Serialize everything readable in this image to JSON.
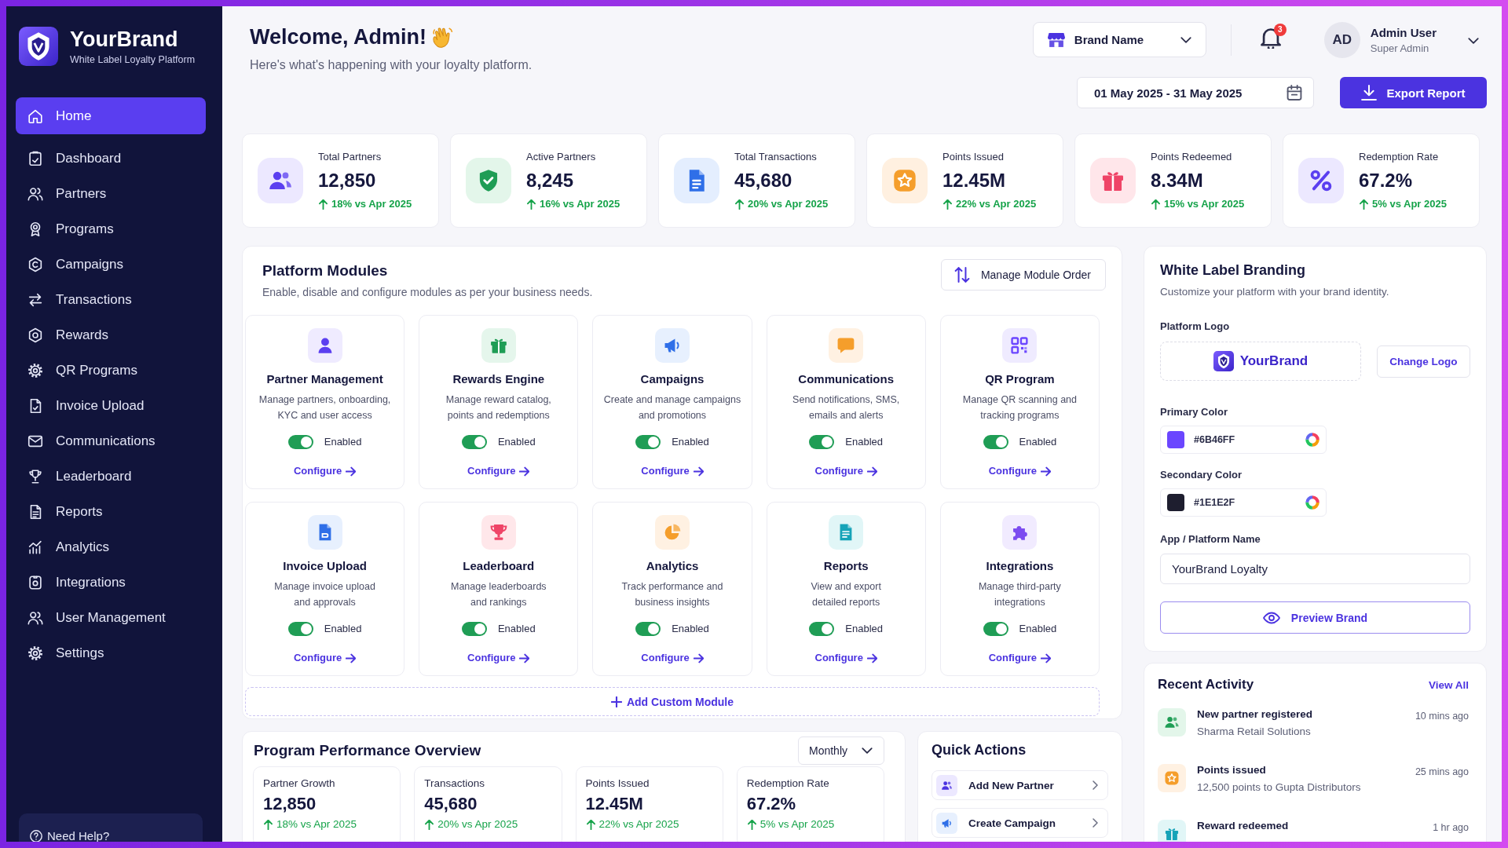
{
  "sidebar": {
    "brand": {
      "name": "YourBrand",
      "tagline": "White Label Loyalty Platform"
    },
    "items": [
      {
        "label": "Home",
        "selected": true
      },
      {
        "label": "Dashboard",
        "selected": false
      },
      {
        "label": "Partners",
        "selected": false
      },
      {
        "label": "Programs",
        "selected": false
      },
      {
        "label": "Campaigns",
        "selected": false
      },
      {
        "label": "Transactions",
        "selected": false
      },
      {
        "label": "Rewards",
        "selected": false
      },
      {
        "label": "QR Programs",
        "selected": false
      },
      {
        "label": "Invoice Upload",
        "selected": false
      },
      {
        "label": "Communications",
        "selected": false
      },
      {
        "label": "Leaderboard",
        "selected": false
      },
      {
        "label": "Reports",
        "selected": false
      },
      {
        "label": "Analytics",
        "selected": false
      },
      {
        "label": "Integrations",
        "selected": false
      },
      {
        "label": "User Management",
        "selected": false
      },
      {
        "label": "Settings",
        "selected": false
      }
    ],
    "help": {
      "label": "Need Help?"
    }
  },
  "header": {
    "title": "Welcome, Admin!",
    "subtitle": "Here's what's happening with your loyalty platform.",
    "brand_selector": {
      "value": "Brand Name"
    },
    "notifications": {
      "count": "3"
    },
    "user": {
      "initials": "AD",
      "name": "Admin User",
      "role": "Super Admin"
    },
    "date_range": {
      "value": "01 May 2025 - 31 May 2025"
    },
    "export_button": {
      "label": "Export Report"
    }
  },
  "stats": [
    {
      "label": "Total Partners",
      "value": "12,850",
      "change": "18% vs Apr 2025"
    },
    {
      "label": "Active Partners",
      "value": "8,245",
      "change": "16% vs Apr 2025"
    },
    {
      "label": "Total Transactions",
      "value": "45,680",
      "change": "20% vs Apr 2025"
    },
    {
      "label": "Points Issued",
      "value": "12.45M",
      "change": "22% vs Apr 2025"
    },
    {
      "label": "Points Redeemed",
      "value": "8.34M",
      "change": "15% vs Apr 2025"
    },
    {
      "label": "Redemption Rate",
      "value": "67.2%",
      "change": "5% vs Apr 2025"
    }
  ],
  "modules": {
    "title": "Platform Modules",
    "subtitle": "Enable, disable and configure modules as per your business needs.",
    "order_button": {
      "label": "Manage Module Order"
    },
    "items": [
      {
        "name": "Partner Management",
        "description": "Manage partners, onboarding,\nKYC and user access",
        "on": true,
        "status": "Enabled",
        "action": "Configure"
      },
      {
        "name": "Rewards Engine",
        "description": "Manage reward catalog,\npoints and redemptions",
        "on": true,
        "status": "Enabled",
        "action": "Configure"
      },
      {
        "name": "Campaigns",
        "description": "Create and manage campaigns\nand promotions",
        "on": true,
        "status": "Enabled",
        "action": "Configure"
      },
      {
        "name": "Communications",
        "description": "Send notifications, SMS,\nemails and alerts",
        "on": true,
        "status": "Enabled",
        "action": "Configure"
      },
      {
        "name": "QR Program",
        "description": "Manage QR scanning and\ntracking programs",
        "on": true,
        "status": "Enabled",
        "action": "Configure"
      },
      {
        "name": "Invoice Upload",
        "description": "Manage invoice upload\nand approvals",
        "on": true,
        "status": "Enabled",
        "action": "Configure"
      },
      {
        "name": "Leaderboard",
        "description": "Manage leaderboards\nand rankings",
        "on": true,
        "status": "Enabled",
        "action": "Configure"
      },
      {
        "name": "Analytics",
        "description": "Track performance and\nbusiness insights",
        "on": true,
        "status": "Enabled",
        "action": "Configure"
      },
      {
        "name": "Reports",
        "description": "View and export\ndetailed reports",
        "on": true,
        "status": "Enabled",
        "action": "Configure"
      },
      {
        "name": "Integrations",
        "description": "Manage third-party\nintegrations",
        "on": true,
        "status": "Enabled",
        "action": "Configure"
      }
    ],
    "add_button": {
      "label": "Add Custom Module"
    }
  },
  "performance": {
    "title": "Program Performance Overview",
    "period": {
      "value": "Monthly"
    },
    "metrics": [
      {
        "label": "Partner Growth",
        "value": "12,850",
        "change": "18% vs Apr 2025"
      },
      {
        "label": "Transactions",
        "value": "45,680",
        "change": "20% vs Apr 2025"
      },
      {
        "label": "Points Issued",
        "value": "12.45M",
        "change": "22% vs Apr 2025"
      },
      {
        "label": "Redemption Rate",
        "value": "67.2%",
        "change": "5% vs Apr 2025"
      }
    ]
  },
  "quick_actions": {
    "title": "Quick Actions",
    "items": [
      {
        "label": "Add New Partner"
      },
      {
        "label": "Create Campaign"
      }
    ]
  },
  "branding": {
    "title": "White Label Branding",
    "subtitle": "Customize your platform with your brand identity.",
    "logo": {
      "label": "Platform Logo",
      "brand": "YourBrand",
      "change_button": "Change Logo"
    },
    "colors": [
      {
        "label": "Primary Color",
        "value": "#6B46FF",
        "color": "#6b46ff"
      },
      {
        "label": "Secondary Color",
        "value": "#1E1E2F",
        "color": "#1e1e2f"
      }
    ],
    "app_name": {
      "label": "App / Platform Name",
      "value": "YourBrand Loyalty"
    },
    "preview_button": {
      "label": "Preview Brand"
    }
  },
  "recent_activity": {
    "title": "Recent Activity",
    "view_all": "View All",
    "items": [
      {
        "title": "New partner registered",
        "detail": "Sharma Retail Solutions",
        "time": "10 mins ago"
      },
      {
        "title": "Points issued",
        "detail": "12,500 points to Gupta Distributors",
        "time": "25 mins ago"
      },
      {
        "title": "Reward redeemed",
        "time": "1 hr ago"
      }
    ]
  }
}
